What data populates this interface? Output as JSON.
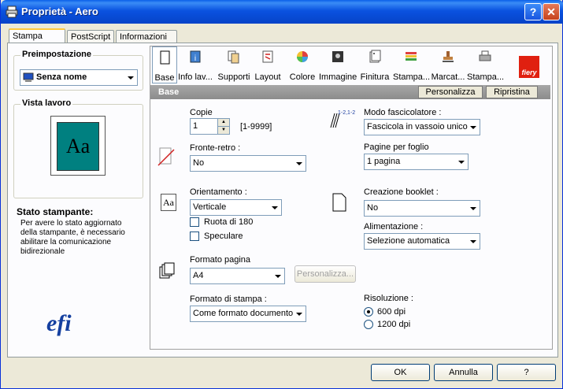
{
  "window": {
    "title": "Proprietà - Aero",
    "help": "?",
    "close": "✕"
  },
  "tabs": [
    "Stampa Fiery",
    "PostScript",
    "Informazioni su"
  ],
  "preset": {
    "label": "Preimpostazione",
    "value": "Senza nome"
  },
  "preview": {
    "label": "Vista lavoro",
    "sample": "Aa"
  },
  "printer_status": {
    "label": "Stato stampante:",
    "text": "Per avere lo stato aggiornato della stampante, è necessario abilitare la comunicazione bidirezionale"
  },
  "toolbar": [
    "Base",
    "Info lav...",
    "Supporti",
    "Layout",
    "Colore",
    "Immagine",
    "Finitura",
    "Stampa...",
    "Marcat...",
    "Stampa..."
  ],
  "brand": {
    "fiery": "fiery",
    "efi": "efi"
  },
  "section": {
    "title": "Base",
    "customize": "Personalizza",
    "restore": "Ripristina"
  },
  "fields": {
    "copies_label": "Copie",
    "copies_value": "1",
    "copies_range": "[1-9999]",
    "duplex_label": "Fronte-retro :",
    "duplex_value": "No",
    "orientation_label": "Orientamento :",
    "orientation_value": "Verticale",
    "rotate_label": "Ruota di 180",
    "mirror_label": "Speculare",
    "page_size_label": "Formato pagina",
    "page_size_value": "A4",
    "page_size_custom": "Personalizza...",
    "print_size_label": "Formato di stampa :",
    "print_size_value": "Come formato documento",
    "collator_label": "Modo fascicolatore :",
    "collator_value": "Fascicola in vassoio unico",
    "collator_icon_text": "1-2,1-2",
    "pages_per_sheet_label": "Pagine per foglio",
    "pages_per_sheet_value": "1 pagina",
    "booklet_label": "Creazione booklet :",
    "booklet_value": "No",
    "feed_label": "Alimentazione :",
    "feed_value": "Selezione automatica",
    "resolution_label": "Risoluzione :",
    "res_600": "600 dpi",
    "res_1200": "1200 dpi",
    "orientation_icon_text": "Aa"
  },
  "buttons": {
    "ok": "OK",
    "cancel": "Annulla",
    "help": "?"
  }
}
